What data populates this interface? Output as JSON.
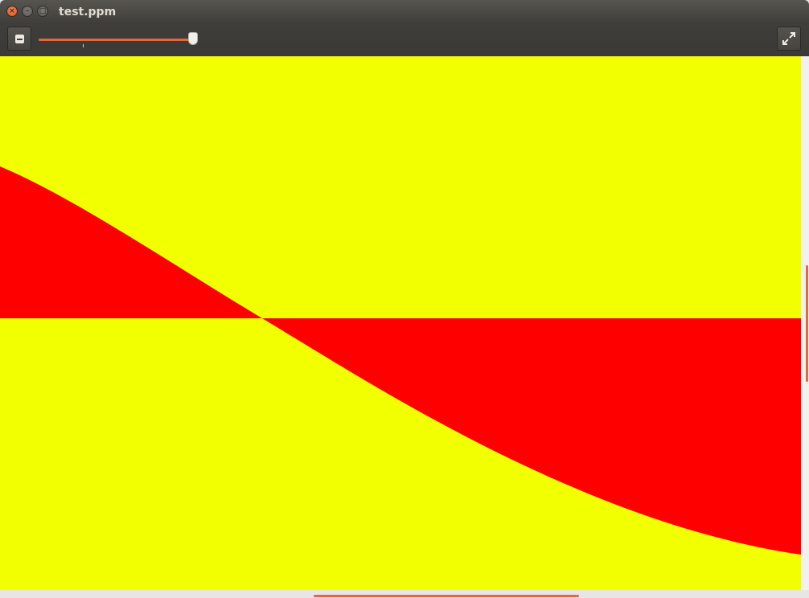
{
  "window": {
    "title": "test.ppm",
    "controls": {
      "close": "×",
      "minimize": "–",
      "maximize": "□"
    }
  },
  "toolbar": {
    "zoom_out_icon": "zoom-out-icon",
    "fullscreen_icon": "fullscreen-icon",
    "zoom_level_fraction": 0.99
  },
  "image": {
    "background_color": "#f2ff00",
    "shape_color": "#ff0000"
  },
  "colors": {
    "accent": "#e4683a"
  }
}
